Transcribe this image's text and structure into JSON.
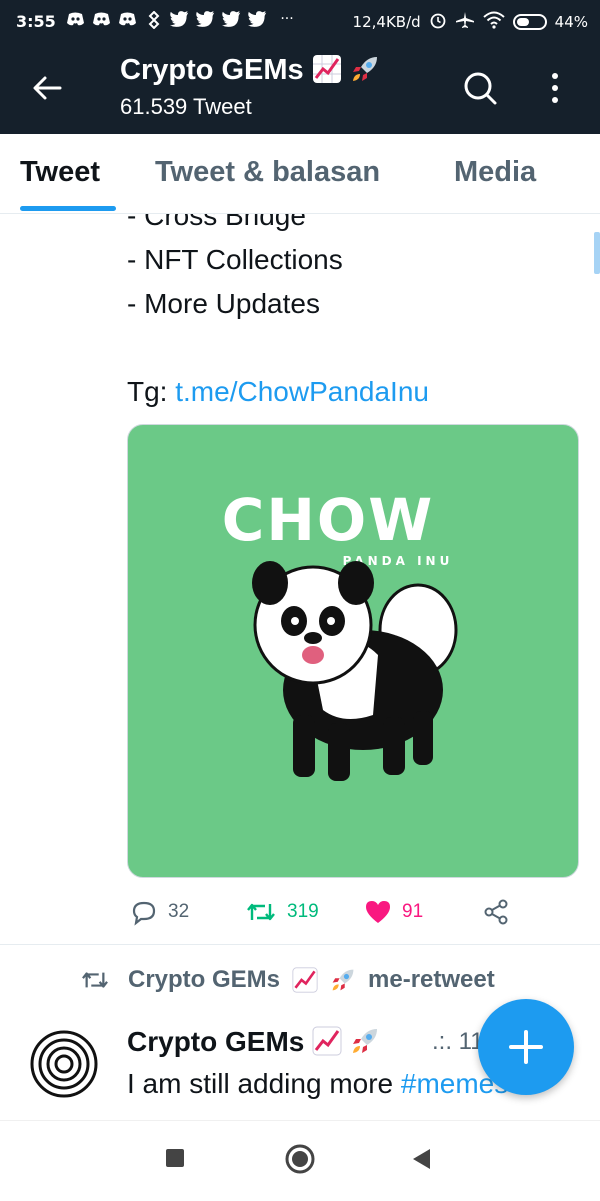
{
  "status_bar": {
    "time": "3:55",
    "net_speed": "12,4KB/d",
    "battery": "44%",
    "notification_icons": [
      "discord-icon",
      "discord-icon",
      "discord-icon",
      "binance-icon",
      "twitter-icon",
      "twitter-icon",
      "twitter-icon",
      "twitter-icon"
    ],
    "more_indicator": "···"
  },
  "header": {
    "title": "Crypto GEMs",
    "tweet_count": "61.539 Tweet",
    "title_emoji": [
      "chart-increasing-emoji",
      "rocket-emoji"
    ]
  },
  "tabs": [
    {
      "label": "Tweet",
      "active": true
    },
    {
      "label": "Tweet & balasan",
      "active": false
    },
    {
      "label": "Media",
      "active": false
    }
  ],
  "tweet": {
    "lines": [
      "- Cross Bridge",
      "- NFT Collections",
      "- More Updates"
    ],
    "tg_label": "Tg:",
    "tg_link": "t.me/ChowPandaInu",
    "media": {
      "logo_text": "CHOW",
      "logo_sub": "PANDA INU",
      "background": "#6bc987"
    },
    "replies": "32",
    "retweets": "319",
    "likes": "91"
  },
  "retweet_banner": {
    "name": "Crypto GEMs",
    "suffix": "me-retweet"
  },
  "tweet2": {
    "name": "Crypto GEMs",
    "meta": ".:. 11",
    "text_before": "I am still adding more ",
    "hashtag": "#memes"
  },
  "colors": {
    "header_bg": "#15202b",
    "accent": "#1d9bf0",
    "retweet": "#00ba7c",
    "like": "#f91880"
  }
}
